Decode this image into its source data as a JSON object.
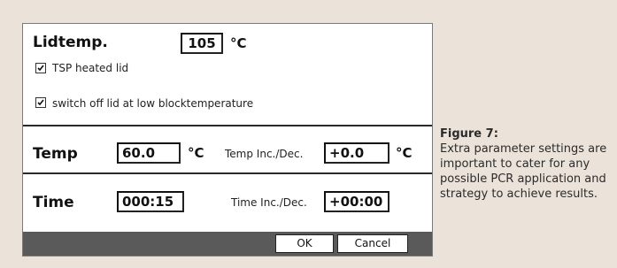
{
  "dialog": {
    "lid_label": "Lidtemp.",
    "lid_value": "105",
    "lid_unit": "°C",
    "checkbox_heated_lid": "TSP heated lid",
    "checkbox_switch_off": "switch off lid at low blocktemperature",
    "temp_label": "Temp",
    "temp_value": "60.0",
    "temp_unit": "°C",
    "temp_inc_label": "Temp Inc./Dec.",
    "temp_inc_value": "+0.0",
    "temp_inc_unit": "°C",
    "time_label": "Time",
    "time_value": "000:15",
    "time_inc_label": "Time Inc./Dec.",
    "time_inc_value": "+00:00",
    "ok_label": "OK",
    "cancel_label": "Cancel"
  },
  "caption": {
    "title": "Figure 7:",
    "text": "Extra parameter settings are important to cater for any possible PCR application and strategy to achieve results."
  }
}
